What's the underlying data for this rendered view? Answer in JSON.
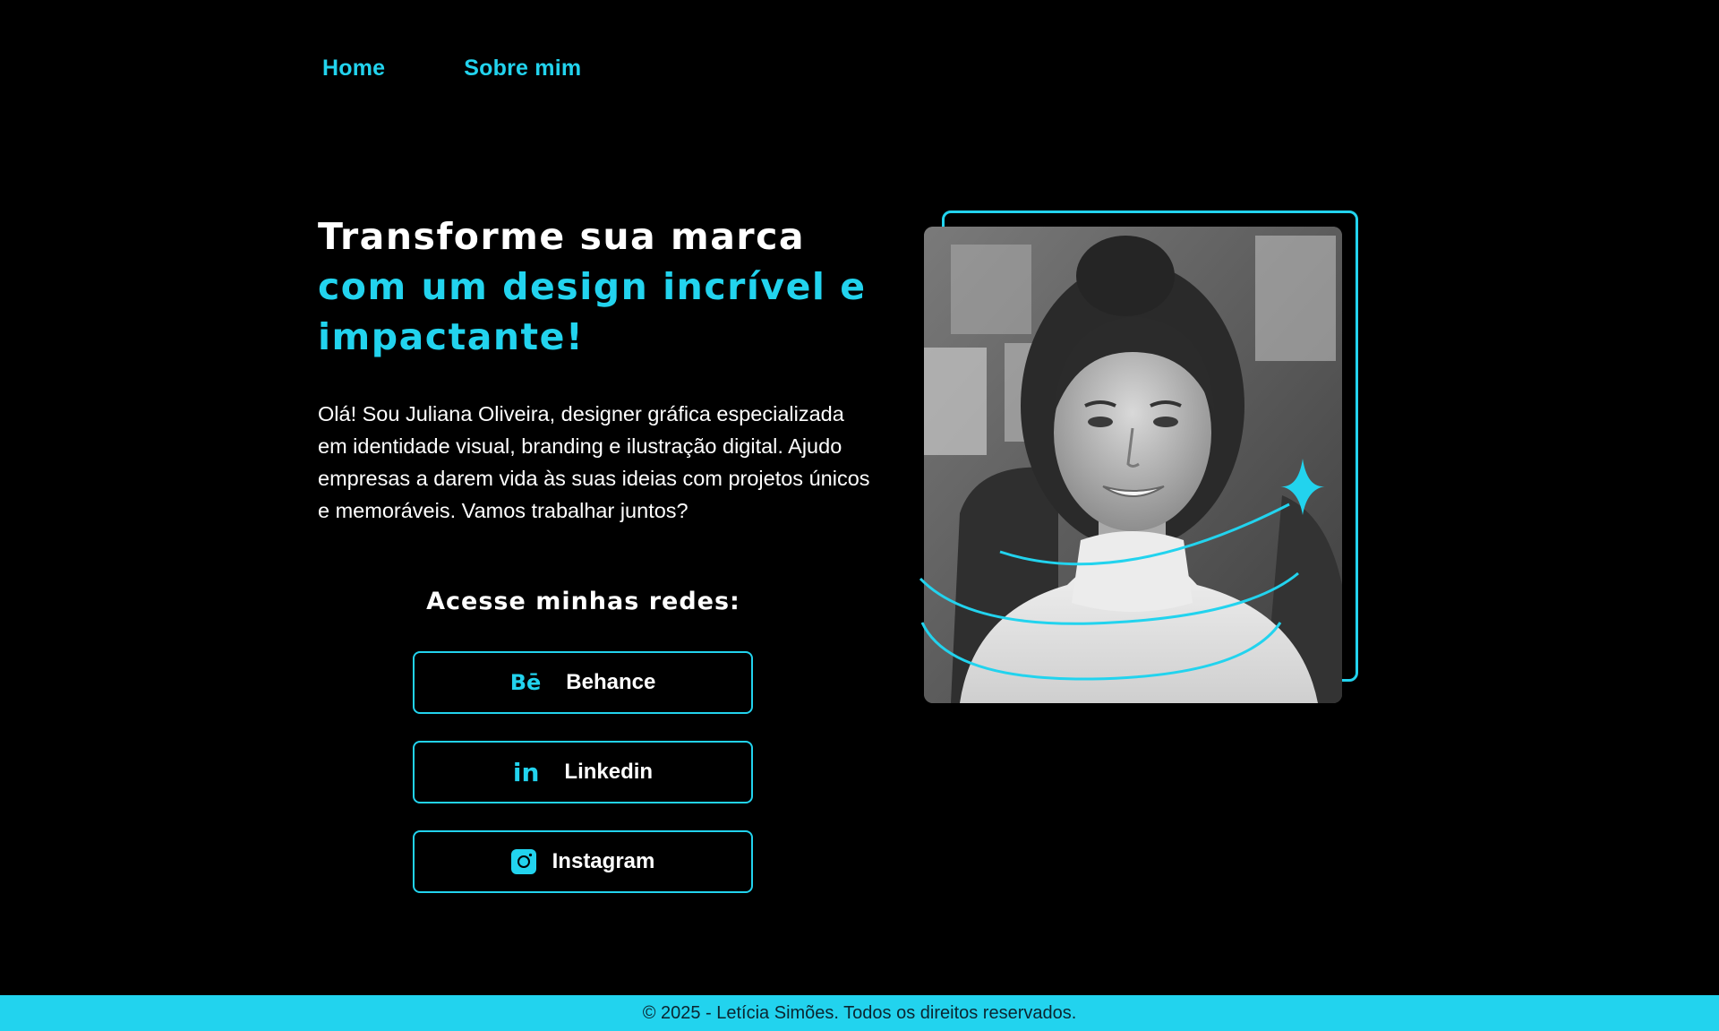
{
  "nav": {
    "items": [
      {
        "label": "Home"
      },
      {
        "label": "Sobre mim"
      }
    ]
  },
  "hero": {
    "title_line1": "Transforme sua marca",
    "title_accent": "com um design incrível e impactante!",
    "intro": "Olá! Sou Juliana Oliveira, designer gráfica especializada em identidade visual, branding e ilustração digital. Ajudo empresas a darem vida às suas ideias com projetos únicos e memoráveis. Vamos trabalhar juntos?"
  },
  "social": {
    "heading": "Acesse minhas redes:",
    "buttons": [
      {
        "label": "Behance",
        "icon": "behance-icon",
        "glyph": "Bē"
      },
      {
        "label": "Linkedin",
        "icon": "linkedin-icon",
        "glyph": "in"
      },
      {
        "label": "Instagram",
        "icon": "instagram-icon"
      }
    ]
  },
  "photo": {
    "alt": "Retrato de designer sorrindo"
  },
  "colors": {
    "accent": "#22d3ee",
    "background": "#000000",
    "text": "#ffffff"
  },
  "footer": {
    "text": "© 2025 - Letícia Simões. Todos os direitos reservados."
  }
}
